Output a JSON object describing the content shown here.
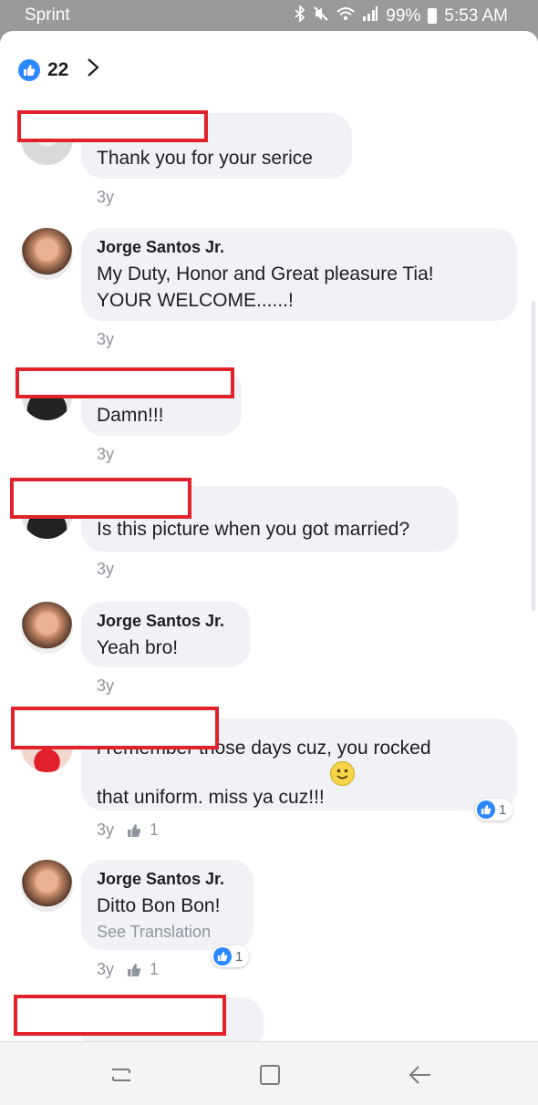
{
  "status_bar": {
    "carrier": "Sprint",
    "battery": "99%",
    "time": "5:53 AM",
    "icons": [
      "bluetooth-icon",
      "mute-icon",
      "wifi-icon",
      "signal-icon",
      "battery-icon"
    ]
  },
  "header": {
    "like_count": "22",
    "icon": "like-icon",
    "chevron": "chevron-right-icon",
    "accent_color": "#2d88ff"
  },
  "comments": [
    {
      "author": "",
      "text": "Thank you for your serice",
      "time": "3y"
    },
    {
      "author": "Jorge Santos Jr.",
      "text": "My Duty, Honor and Great pleasure Tia!\nYOUR WELCOME......!",
      "time": "3y"
    },
    {
      "author": "",
      "text": "Damn!!!",
      "time": "3y"
    },
    {
      "author": "",
      "text": "Is this picture when you got married?",
      "time": "3y"
    },
    {
      "author": "Jorge Santos Jr.",
      "text": "Yeah bro!",
      "time": "3y"
    },
    {
      "author": "",
      "text": "i remember those days cuz,  you rocked\nthat uniform.  miss ya cuz!!!",
      "time": "3y",
      "likes": "1",
      "reactions": "1",
      "emoji": "smiley-emoji"
    },
    {
      "author": "Jorge Santos Jr.",
      "text": "Ditto Bon Bon!",
      "translation": "See Translation",
      "time": "3y",
      "likes": "1",
      "reactions": "1"
    }
  ],
  "nav_bar": {
    "buttons": [
      "recent-apps-icon",
      "home-icon",
      "back-icon"
    ]
  }
}
